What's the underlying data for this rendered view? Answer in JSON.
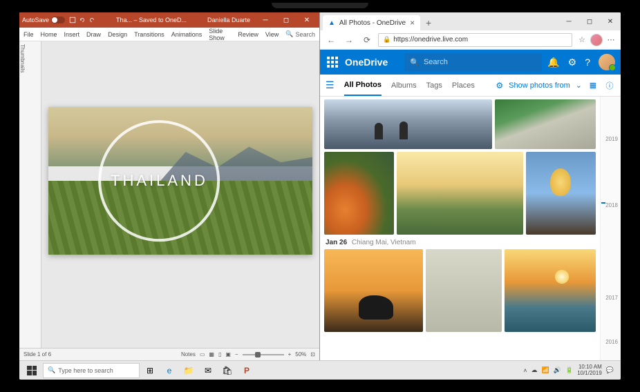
{
  "powerpoint": {
    "autosave_label": "AutoSave",
    "title": "Tha... – Saved to OneD...",
    "user": "Daniella Duarte",
    "ribbon_tabs": [
      "File",
      "Home",
      "Insert",
      "Draw",
      "Design",
      "Transitions",
      "Animations",
      "Slide Show",
      "Review",
      "View"
    ],
    "search_label": "Search",
    "thumbnails_label": "Thumbnails",
    "slide_text": "THAILAND",
    "status_slide": "Slide 1 of 6",
    "status_notes": "Notes",
    "zoom": "50%"
  },
  "browser": {
    "tab_title": "All Photos - OneDrive",
    "url": "https://onedrive.live.com",
    "onedrive": {
      "brand": "OneDrive",
      "search_placeholder": "Search",
      "tabs": [
        "All Photos",
        "Albums",
        "Tags",
        "Places"
      ],
      "show_from": "Show photos from",
      "section_date": "Jan 26",
      "section_location": "Chiang Mai, Vietnam",
      "timeline_years": [
        "2019",
        "2018",
        "2017",
        "2016"
      ]
    }
  },
  "taskbar": {
    "search_placeholder": "Type here to search",
    "time": "10:10 AM",
    "date": "10/1/2019"
  }
}
